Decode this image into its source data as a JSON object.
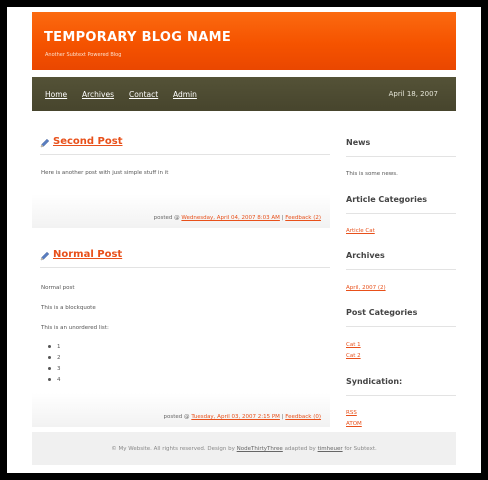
{
  "header": {
    "title": "TEMPORARY BLOG NAME",
    "tagline": "Another Subtext Powered Blog"
  },
  "nav": {
    "items": [
      {
        "label": "Home"
      },
      {
        "label": "Archives"
      },
      {
        "label": "Contact"
      },
      {
        "label": "Admin"
      }
    ],
    "date": "April 18, 2007"
  },
  "posts": [
    {
      "title": "Second Post",
      "body": "Here is another post with just simple stuff in it",
      "posted_prefix": "posted @",
      "date_link": "Wednesday, April 04, 2007 8:03 AM",
      "separator": "|",
      "feedback": "Feedback (2)"
    },
    {
      "title": "Normal Post",
      "paragraphs": [
        "Normal post",
        "This is a blockquote",
        "This is an unordered list:"
      ],
      "list": [
        "1",
        "2",
        "3",
        "4"
      ],
      "posted_prefix": "posted @",
      "date_link": "Tuesday, April 03, 2007 2:15 PM",
      "separator": "|",
      "feedback": "Feedback (0)"
    }
  ],
  "sidebar": {
    "news": {
      "heading": "News",
      "text": "This is some news."
    },
    "article_categories": {
      "heading": "Article Categories",
      "links": [
        "Article Cat"
      ]
    },
    "archives": {
      "heading": "Archives",
      "links": [
        "April, 2007 (2)"
      ]
    },
    "post_categories": {
      "heading": "Post Categories",
      "links": [
        "Cat 1",
        "Cat 2"
      ]
    },
    "syndication": {
      "heading": "Syndication:",
      "links": [
        "RSS",
        "ATOM"
      ]
    }
  },
  "footer": {
    "text_before": "© My Website. All rights reserved. Design by",
    "designer": "NodeThirtyThree",
    "text_middle": "adapted by",
    "adapter": "timheuer",
    "text_after": "for Subtext."
  },
  "colors": {
    "header_orange": "#f55300",
    "nav_olive": "#4c4a31",
    "link_orange": "#e8501a"
  }
}
